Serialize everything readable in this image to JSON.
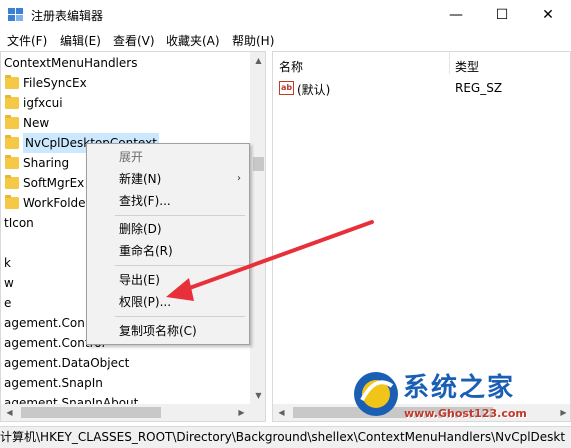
{
  "window": {
    "title": "注册表编辑器",
    "minimize_glyph": "—",
    "maximize_glyph": "☐",
    "close_glyph": "✕"
  },
  "menu": [
    "文件(F)",
    "编辑(E)",
    "查看(V)",
    "收藏夹(A)",
    "帮助(H)"
  ],
  "tree": [
    {
      "label": "ContextMenuHandlers",
      "folder": false,
      "selected": false
    },
    {
      "label": "FileSyncEx",
      "folder": true,
      "selected": false
    },
    {
      "label": "igfxcui",
      "folder": true,
      "selected": false
    },
    {
      "label": "New",
      "folder": true,
      "selected": false
    },
    {
      "label": "NvCplDesktopContext",
      "folder": true,
      "selected": true
    },
    {
      "label": "Sharing",
      "folder": true,
      "selected": false
    },
    {
      "label": "SoftMgrEx",
      "folder": true,
      "selected": false
    },
    {
      "label": "WorkFolders",
      "folder": true,
      "selected": false
    },
    {
      "label": "tIcon",
      "folder": false,
      "selected": false
    },
    {
      "label": "",
      "folder": false,
      "selected": false
    },
    {
      "label": "k",
      "folder": false,
      "selected": false
    },
    {
      "label": "w",
      "folder": false,
      "selected": false
    },
    {
      "label": "e",
      "folder": false,
      "selected": false
    },
    {
      "label": "agement.Conn",
      "folder": false,
      "selected": false
    },
    {
      "label": "agement.Control",
      "folder": false,
      "selected": false
    },
    {
      "label": "agement.DataObject",
      "folder": false,
      "selected": false
    },
    {
      "label": "agement.SnapIn",
      "folder": false,
      "selected": false
    },
    {
      "label": "agement.SnapInAbout",
      "folder": false,
      "selected": false
    }
  ],
  "list": {
    "columns": [
      "名称",
      "类型"
    ],
    "rows": [
      {
        "icon": "ab",
        "name": "(默认)",
        "type": "REG_SZ"
      }
    ]
  },
  "context_menu": {
    "items": [
      {
        "label": "展开",
        "disabled": true,
        "submenu": false
      },
      {
        "label": "新建(N)",
        "disabled": false,
        "submenu": true
      },
      {
        "label": "查找(F)...",
        "disabled": false,
        "submenu": false
      },
      {
        "label": "删除(D)",
        "disabled": false,
        "submenu": false
      },
      {
        "label": "重命名(R)",
        "disabled": false,
        "submenu": false
      },
      {
        "label": "导出(E)",
        "disabled": false,
        "submenu": false
      },
      {
        "label": "权限(P)...",
        "disabled": false,
        "submenu": false
      },
      {
        "label": "复制项名称(C)",
        "disabled": false,
        "submenu": false
      }
    ],
    "submenu_glyph": "›"
  },
  "status_path": "计算机\\HKEY_CLASSES_ROOT\\Directory\\Background\\shellex\\ContextMenuHandlers\\NvCplDeskt",
  "watermark": {
    "title": "系统之家",
    "url": "www.Ghost123.com"
  },
  "colors": {
    "selection": "#cce8ff",
    "folder": "#f5c946",
    "arrow": "#e8303a",
    "watermark_blue": "#1a5fb4",
    "watermark_red": "#c0392b"
  }
}
